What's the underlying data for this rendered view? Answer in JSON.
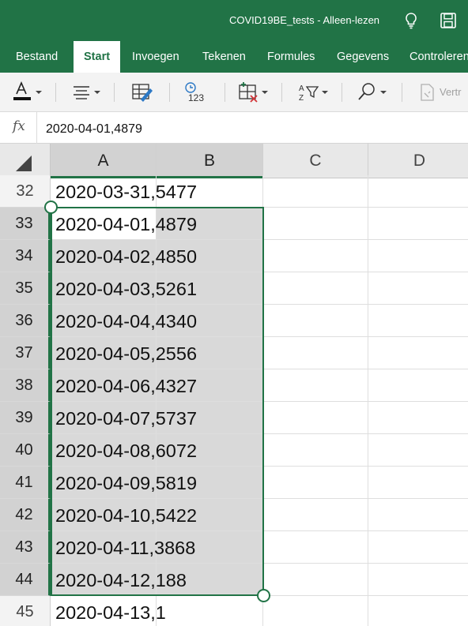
{
  "title_bar": {
    "title": "COVID19BE_tests - Alleen-lezen",
    "icons": [
      "lightbulb-icon",
      "save-icon"
    ]
  },
  "ribbon": {
    "tabs": [
      {
        "label": "Bestand",
        "active": false
      },
      {
        "label": "Start",
        "active": true
      },
      {
        "label": "Invoegen",
        "active": false
      },
      {
        "label": "Tekenen",
        "active": false
      },
      {
        "label": "Formules",
        "active": false
      },
      {
        "label": "Gegevens",
        "active": false
      },
      {
        "label": "Controleren",
        "active": false
      }
    ]
  },
  "toolbar": {
    "font_color_icon": "font-color-icon",
    "font_color_accent": "#c00000",
    "number_format_label": "123",
    "sort_label_top": "A",
    "sort_label_bottom": "Z",
    "truncated_button_label": "Vertr"
  },
  "formula_bar": {
    "fx_label": "fx",
    "value": "2020-04-01,4879"
  },
  "grid": {
    "columns": [
      "A",
      "B",
      "C",
      "D"
    ],
    "selected_columns": [
      "A",
      "B"
    ],
    "rows": [
      {
        "num": "32",
        "text": "2020-03-31,5477",
        "selected": false
      },
      {
        "num": "33",
        "text": "2020-04-01,4879",
        "selected": true,
        "active": true
      },
      {
        "num": "34",
        "text": "2020-04-02,4850",
        "selected": true
      },
      {
        "num": "35",
        "text": "2020-04-03,5261",
        "selected": true
      },
      {
        "num": "36",
        "text": "2020-04-04,4340",
        "selected": true
      },
      {
        "num": "37",
        "text": "2020-04-05,2556",
        "selected": true
      },
      {
        "num": "38",
        "text": "2020-04-06,4327",
        "selected": true
      },
      {
        "num": "39",
        "text": "2020-04-07,5737",
        "selected": true
      },
      {
        "num": "40",
        "text": "2020-04-08,6072",
        "selected": true
      },
      {
        "num": "41",
        "text": "2020-04-09,5819",
        "selected": true
      },
      {
        "num": "42",
        "text": "2020-04-10,5422",
        "selected": true
      },
      {
        "num": "43",
        "text": "2020-04-11,3868",
        "selected": true
      },
      {
        "num": "44",
        "text": "2020-04-12,188",
        "selected": true
      },
      {
        "num": "45",
        "text": "2020-04-13,1",
        "selected": false
      }
    ]
  },
  "colors": {
    "brand_green": "#217346",
    "selection_fill": "#d9d9d9",
    "header_selected": "#d2d2d2"
  }
}
